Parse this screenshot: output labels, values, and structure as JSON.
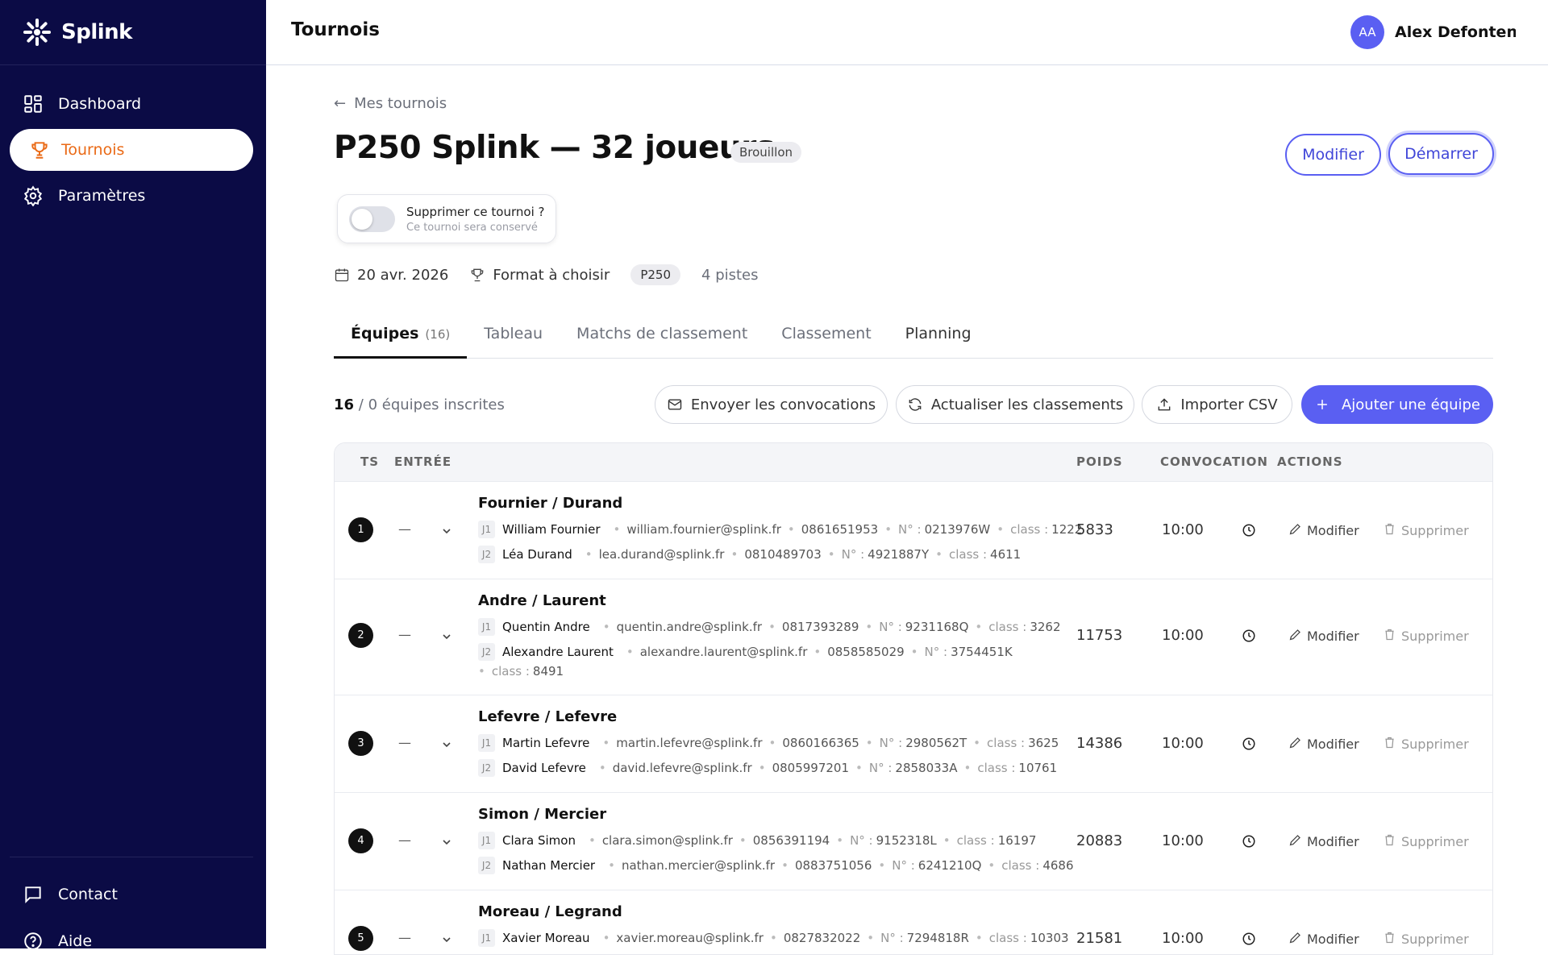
{
  "app": {
    "name": "Splink"
  },
  "sidebar": {
    "items": [
      {
        "label": "Dashboard",
        "icon": "grid-icon"
      },
      {
        "label": "Tournois",
        "icon": "trophy-icon",
        "active": true
      },
      {
        "label": "Paramètres",
        "icon": "gear-icon"
      }
    ],
    "bottom": [
      {
        "label": "Contact",
        "icon": "chat-icon"
      },
      {
        "label": "Aide",
        "icon": "help-icon"
      }
    ]
  },
  "header": {
    "title": "Tournois",
    "user": {
      "initials": "AA",
      "name": "Alex Defontena..."
    }
  },
  "page": {
    "back": "Mes tournois",
    "title": "P250 Splink — 32 joueurs",
    "status": "Brouillon",
    "buttons": {
      "modify": "Modifier",
      "start": "Démarrer"
    },
    "delete_toggle": {
      "label": "Supprimer ce tournoi ?",
      "hint": "Ce tournoi sera conservé",
      "on": false
    },
    "meta": {
      "date": "20 avr. 2026",
      "format": "Format à choisir",
      "level": "P250",
      "courts": "4 pistes"
    },
    "tabs": [
      {
        "label": "Équipes",
        "count": "(16)",
        "active": true
      },
      {
        "label": "Tableau"
      },
      {
        "label": "Matchs de classement"
      },
      {
        "label": "Classement"
      },
      {
        "label": "Planning"
      }
    ],
    "count": {
      "registered": "16",
      "rest": "/ 0 équipes inscrites"
    },
    "toolbar": {
      "send": "Envoyer les convocations",
      "refresh": "Actualiser les classements",
      "import": "Importer CSV",
      "add": "Ajouter une équipe"
    }
  },
  "table": {
    "headers": {
      "ts": "TS",
      "entry": "ENTRÉE",
      "weight": "POIDS",
      "convocation": "CONVOCATION",
      "actions": "ACTIONS"
    },
    "action_labels": {
      "modify": "Modifier",
      "delete": "Supprimer"
    },
    "labels": {
      "j1": "J1",
      "j2": "J2",
      "num": "N° :",
      "class": "class :",
      "dash": "—"
    },
    "rows": [
      {
        "seed": "1",
        "team": "Fournier / Durand",
        "weight": "5833",
        "time": "10:00",
        "p1": {
          "name": "William Fournier",
          "email": "william.fournier@splink.fr",
          "phone": "0861651953",
          "num": "0213976W",
          "class": "1222"
        },
        "p2": {
          "name": "Léa Durand",
          "email": "lea.durand@splink.fr",
          "phone": "0810489703",
          "num": "4921887Y",
          "class": "4611"
        }
      },
      {
        "seed": "2",
        "team": "Andre / Laurent",
        "weight": "11753",
        "time": "10:00",
        "p1": {
          "name": "Quentin Andre",
          "email": "quentin.andre@splink.fr",
          "phone": "0817393289",
          "num": "9231168Q",
          "class": "3262"
        },
        "p2": {
          "name": "Alexandre Laurent",
          "email": "alexandre.laurent@splink.fr",
          "phone": "0858585029",
          "num": "3754451K",
          "class": "8491"
        }
      },
      {
        "seed": "3",
        "team": "Lefevre / Lefevre",
        "weight": "14386",
        "time": "10:00",
        "p1": {
          "name": "Martin Lefevre",
          "email": "martin.lefevre@splink.fr",
          "phone": "0860166365",
          "num": "2980562T",
          "class": "3625"
        },
        "p2": {
          "name": "David Lefevre",
          "email": "david.lefevre@splink.fr",
          "phone": "0805997201",
          "num": "2858033A",
          "class": "10761"
        }
      },
      {
        "seed": "4",
        "team": "Simon / Mercier",
        "weight": "20883",
        "time": "10:00",
        "p1": {
          "name": "Clara Simon",
          "email": "clara.simon@splink.fr",
          "phone": "0856391194",
          "num": "9152318L",
          "class": "16197"
        },
        "p2": {
          "name": "Nathan Mercier",
          "email": "nathan.mercier@splink.fr",
          "phone": "0883751056",
          "num": "6241210Q",
          "class": "4686"
        }
      },
      {
        "seed": "5",
        "team": "Moreau / Legrand",
        "weight": "21581",
        "time": "10:00",
        "p1": {
          "name": "Xavier Moreau",
          "email": "xavier.moreau@splink.fr",
          "phone": "0827832022",
          "num": "7294818R",
          "class": "10303"
        }
      }
    ]
  }
}
